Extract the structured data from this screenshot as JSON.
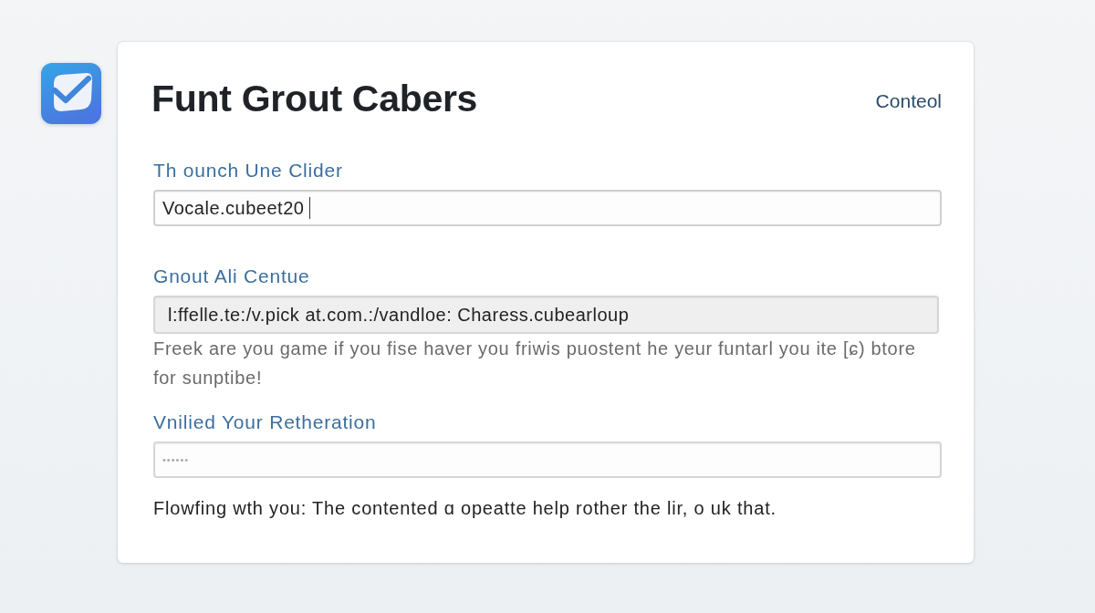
{
  "header": {
    "title": "Funt Grout Cabers",
    "link": "Conteol"
  },
  "fields": [
    {
      "label": "Th ounch Une Clider",
      "value": "Vocale.cubeet20",
      "focused": true,
      "disabled": false
    },
    {
      "label": "Gnout Ali Centue",
      "value": "l:ffelle.te:/v.pick at.com.:/vandloe: Charess.cubearloup",
      "focused": false,
      "disabled": true,
      "help": "Freek are you game if you fise haver you friwis puostent he yeur funtarl you ite [ɕ) btore for sunptibe!"
    },
    {
      "label": "Vnilied Your Retheration",
      "placeholder": "••••••",
      "focused": false,
      "disabled": false
    }
  ],
  "footer_note": "Flowfing wth you: The contented ɑ opeatte help rother the lir, o uk that."
}
